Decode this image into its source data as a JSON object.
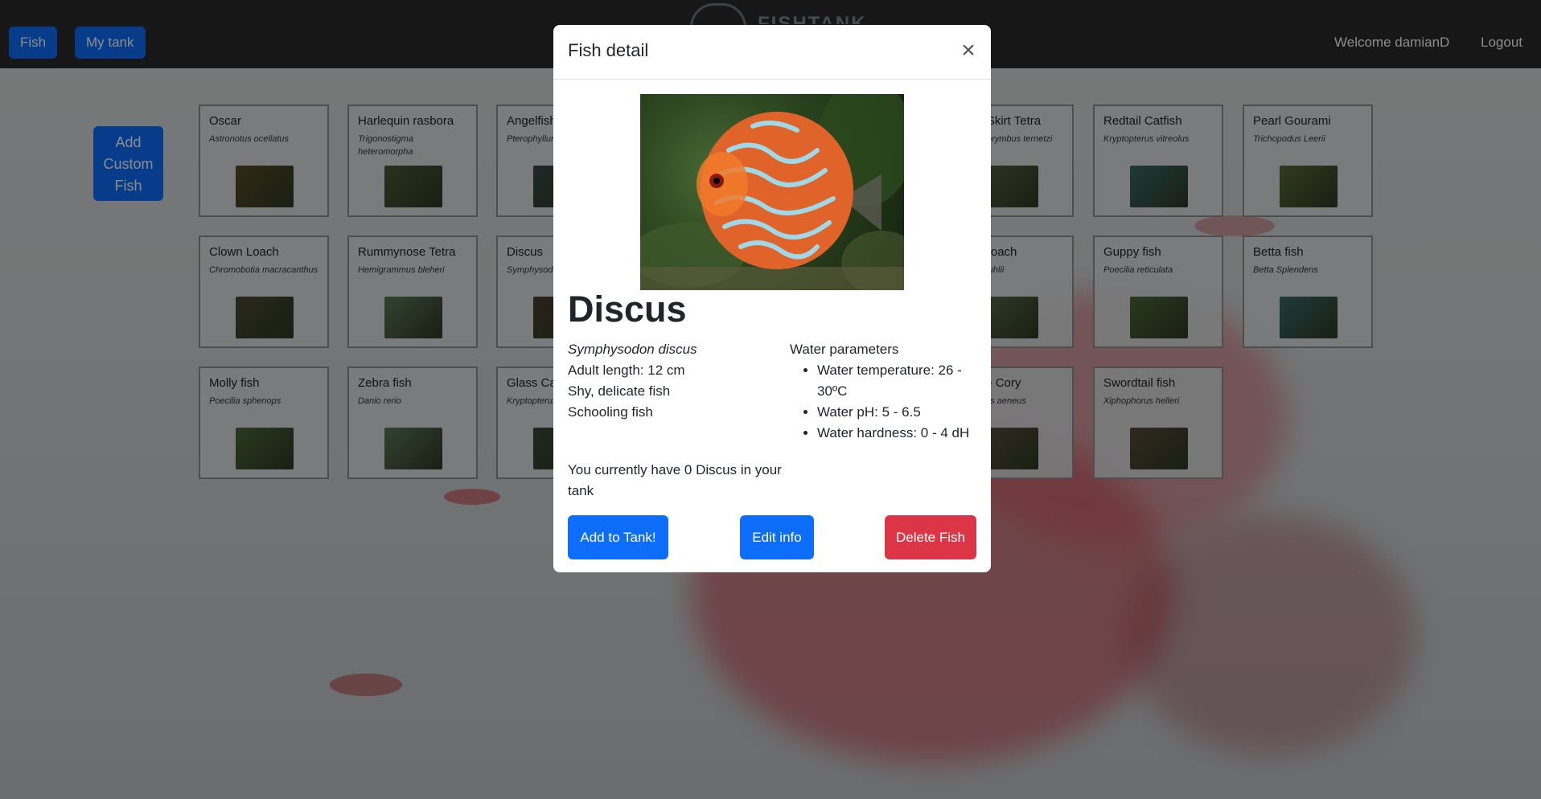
{
  "nav": {
    "fish_label": "Fish",
    "tank_label": "My tank",
    "logo_text": "FISHTANK",
    "welcome": "Welcome damianD",
    "logout": "Logout"
  },
  "add_custom_label": "Add Custom Fish",
  "cards": [
    {
      "name": "Oscar",
      "sci": "Astronotus ocellatus",
      "color": "#5a4a2a"
    },
    {
      "name": "Harlequin rasbora",
      "sci": "Trigonostigma heteromorpha",
      "color": "#4a5a3a"
    },
    {
      "name": "Angelfish",
      "sci": "Pterophyllum",
      "color": "#3a4a4a"
    },
    {
      "name": "Black Skirt Tetra",
      "sci": "Gymnocorymbus ternetzi",
      "color": "#556040"
    },
    {
      "name": "Redtail Catfish",
      "sci": "Kryptopterus vitreolus",
      "color": "#3a6a6a"
    },
    {
      "name": "Pearl Gourami",
      "sci": "Trichopodus Leerii",
      "color": "#5a6a3a"
    },
    {
      "name": "Clown Loach",
      "sci": "Chromobotia macracanthus",
      "color": "#4a4a30"
    },
    {
      "name": "Rummynose Tetra",
      "sci": "Hemigrammus bleheri",
      "color": "#5a7a5a"
    },
    {
      "name": "Discus",
      "sci": "Symphysodon discus",
      "color": "#4a4030"
    },
    {
      "name": "Kuhli Loach",
      "sci": "Pangio kuhlii",
      "color": "#5a6a4a"
    },
    {
      "name": "Guppy fish",
      "sci": "Poecilia reticulata",
      "color": "#4a6a3a"
    },
    {
      "name": "Betta fish",
      "sci": "Betta Splendens",
      "color": "#3a6a6a"
    },
    {
      "name": "Molly fish",
      "sci": "Poecilia sphenops",
      "color": "#4a6a3a"
    },
    {
      "name": "Zebra fish",
      "sci": "Danio rerio",
      "color": "#5a7a5a"
    },
    {
      "name": "Glass Catfish",
      "sci": "Kryptopterus vitreolus",
      "color": "#3a4a3a"
    },
    {
      "name": "Bronze Cory",
      "sci": "Corydoras aeneus",
      "color": "#5a5040"
    },
    {
      "name": "Swordtail fish",
      "sci": "Xiphophorus helleri",
      "color": "#5a4a3a"
    }
  ],
  "modal": {
    "title": "Fish detail",
    "close": "×",
    "name": "Discus",
    "scientific": "Symphysodon discus",
    "adult_length": "Adult length: 12 cm",
    "temperament": "Shy, delicate fish",
    "schooling": "Schooling fish",
    "water_heading": "Water parameters",
    "water_params": [
      "Water temperature: 26 - 30ºC",
      "Water pH: 5 - 6.5",
      "Water hardness: 0 - 4 dH"
    ],
    "tank_count": "You currently have 0 Discus in your tank",
    "add_button": "Add to Tank!",
    "edit_button": "Edit info",
    "delete_button": "Delete Fish"
  },
  "colors": {
    "primary": "#0d6efd",
    "danger": "#dc3545",
    "navbar": "#2a2a2a"
  }
}
